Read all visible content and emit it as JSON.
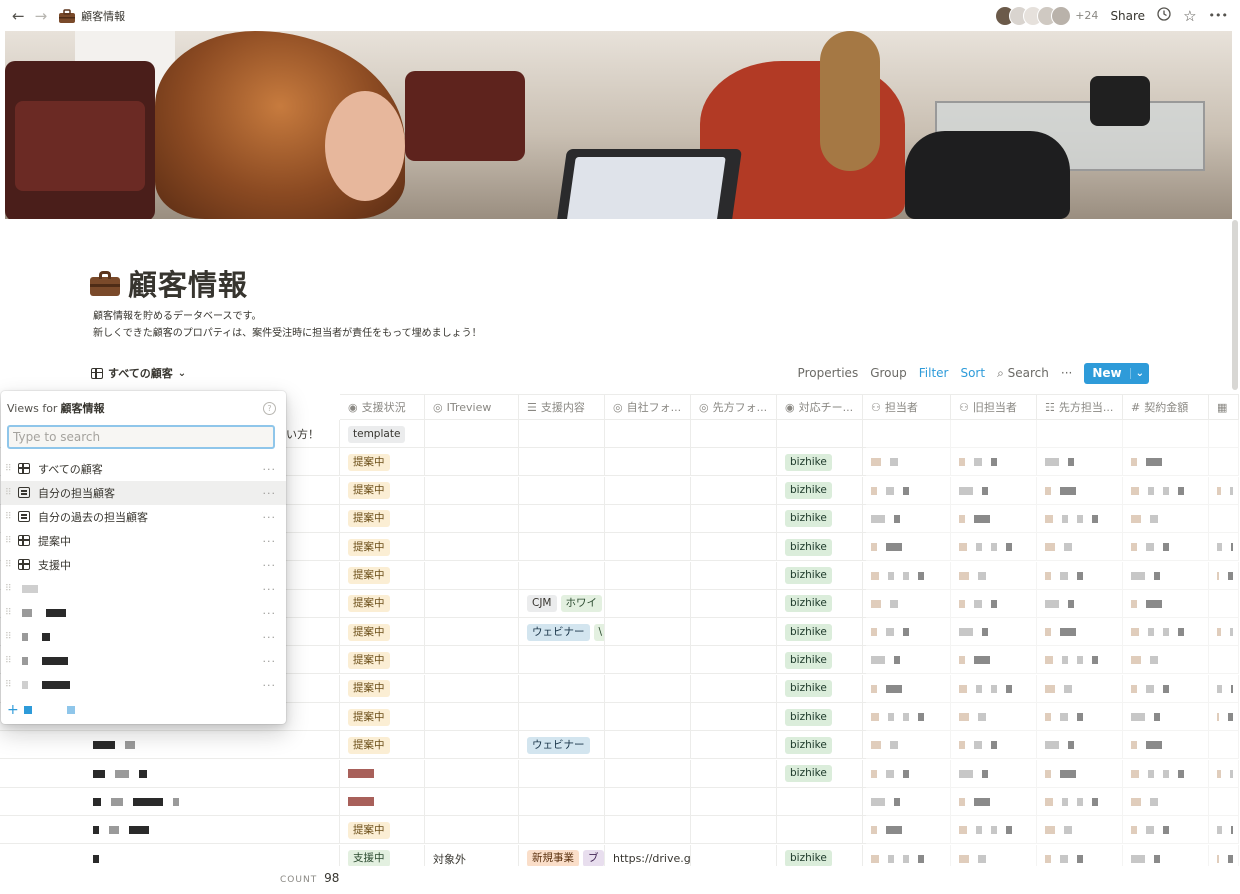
{
  "topbar": {
    "back_icon": "←",
    "forward_icon": "→",
    "page_icon": "briefcase-icon",
    "breadcrumb": "顧客情報",
    "extra_members": "+24",
    "share_label": "Share",
    "history_icon": "🕘",
    "favorite_icon": "☆",
    "more_icon": "•••"
  },
  "page": {
    "title": "顧客情報",
    "description_line1": "顧客情報を貯めるデータベースです。",
    "description_line2": "新しくできた顧客のプロパティは、案件受注時に担当者が責任をもって埋めましょう！"
  },
  "toolbar": {
    "current_view": "すべての顧客",
    "view_caret": "⌄",
    "properties": "Properties",
    "group": "Group",
    "filter": "Filter",
    "sort": "Sort",
    "search": "Search",
    "search_icon": "⌕",
    "more": "···",
    "new_label": "New",
    "new_caret": "⌄"
  },
  "table": {
    "columns": [
      {
        "icon": "◉",
        "label": "支援状況"
      },
      {
        "icon": "◎",
        "label": "ITreview"
      },
      {
        "icon": "☰",
        "label": "支援内容"
      },
      {
        "icon": "◎",
        "label": "自社フォ..."
      },
      {
        "icon": "◎",
        "label": "先方フォ..."
      },
      {
        "icon": "◉",
        "label": "対応チー..."
      },
      {
        "icon": "⚇",
        "label": "担当者"
      },
      {
        "icon": "⚇",
        "label": "旧担当者"
      },
      {
        "icon": "☷",
        "label": "先方担当..."
      },
      {
        "icon": "#",
        "label": "契約金額"
      },
      {
        "icon": "▦",
        "label": ""
      }
    ],
    "rows": [
      {
        "name_suffix": "い方！",
        "status": "template",
        "itreview": "",
        "content": [],
        "own_folder": "",
        "team": ""
      },
      {
        "name_suffix": "",
        "status": "提案中",
        "itreview": "",
        "content": [],
        "own_folder": "",
        "team": "bizhike"
      },
      {
        "name_suffix": "",
        "status": "提案中",
        "itreview": "",
        "content": [],
        "own_folder": "",
        "team": "bizhike"
      },
      {
        "name_suffix": "",
        "status": "提案中",
        "itreview": "",
        "content": [],
        "own_folder": "",
        "team": "bizhike"
      },
      {
        "name_suffix": "",
        "status": "提案中",
        "itreview": "",
        "content": [],
        "own_folder": "",
        "team": "bizhike"
      },
      {
        "name_suffix": "",
        "status": "提案中",
        "itreview": "",
        "content": [],
        "own_folder": "",
        "team": "bizhike"
      },
      {
        "name_suffix": "",
        "status": "提案中",
        "itreview": "",
        "content": [
          "CJM",
          "ホワイ"
        ],
        "own_folder": "",
        "team": "bizhike"
      },
      {
        "name_suffix": "",
        "status": "提案中",
        "itreview": "",
        "content": [
          "ウェビナー",
          "\\"
        ],
        "own_folder": "",
        "team": "bizhike"
      },
      {
        "name_suffix": "",
        "status": "提案中",
        "itreview": "",
        "content": [],
        "own_folder": "",
        "team": "bizhike"
      },
      {
        "name_suffix": "",
        "status": "提案中",
        "itreview": "",
        "content": [],
        "own_folder": "",
        "team": "bizhike"
      },
      {
        "name_suffix": "",
        "status": "提案中",
        "itreview": "",
        "content": [],
        "own_folder": "",
        "team": "bizhike"
      },
      {
        "name_suffix": "",
        "status": "提案中",
        "itreview": "",
        "content": [
          "ウェビナー"
        ],
        "own_folder": "",
        "team": "bizhike"
      },
      {
        "name_suffix": "",
        "status": "",
        "itreview": "",
        "content": [],
        "own_folder": "",
        "team": "bizhike"
      },
      {
        "name_suffix": "",
        "status": "",
        "itreview": "",
        "content": [],
        "own_folder": "",
        "team": ""
      },
      {
        "name_suffix": "",
        "status": "提案中",
        "itreview": "",
        "content": [],
        "own_folder": "",
        "team": ""
      },
      {
        "name_suffix": "",
        "status": "支援中",
        "itreview": "対象外",
        "content": [
          "新規事業",
          "ブ"
        ],
        "own_folder": "https://drive.g",
        "team": "bizhike"
      }
    ],
    "count_label": "COUNT",
    "count_value": "98"
  },
  "views_popup": {
    "heading_prefix": "Views for",
    "heading_db": "顧客情報",
    "help_icon": "?",
    "search_placeholder": "Type to search",
    "items": [
      {
        "icon": "table",
        "label": "すべての顧客"
      },
      {
        "icon": "list",
        "label": "自分の担当顧客"
      },
      {
        "icon": "list",
        "label": "自分の過去の担当顧客"
      },
      {
        "icon": "table",
        "label": "提案中"
      },
      {
        "icon": "table",
        "label": "支援中"
      }
    ],
    "more_icon": "···",
    "add_icon": "+"
  },
  "colors": {
    "accent": "#2e9bd9",
    "text": "#37352f",
    "muted": "#8a8883"
  }
}
